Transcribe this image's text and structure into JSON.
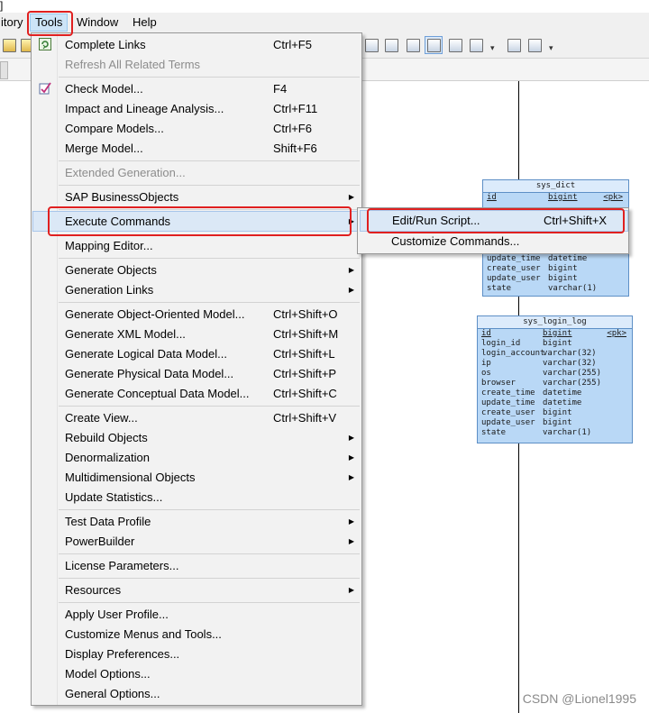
{
  "window": {
    "title_fragment": "]"
  },
  "menubar": [
    {
      "label": "itory"
    },
    {
      "label": "Tools",
      "active": true
    },
    {
      "label": "Window"
    },
    {
      "label": "Help"
    }
  ],
  "tools_menu": {
    "items": [
      {
        "label": "Complete Links",
        "shortcut": "Ctrl+F5"
      },
      {
        "label": "Refresh All Related Terms",
        "shortcut": "",
        "disabled": true
      },
      {
        "label": "Check Model...",
        "shortcut": "F4",
        "icon": "check-model-icon"
      },
      {
        "label": "Impact and Lineage Analysis...",
        "shortcut": "Ctrl+F11"
      },
      {
        "label": "Compare Models...",
        "shortcut": "Ctrl+F6"
      },
      {
        "label": "Merge Model...",
        "shortcut": "Shift+F6"
      },
      {
        "label": "Extended Generation...",
        "shortcut": "",
        "disabled": true
      },
      {
        "label": "SAP BusinessObjects",
        "submenu": true
      },
      {
        "label": "Execute Commands",
        "submenu": true,
        "highlighted": true
      },
      {
        "label": "Mapping Editor..."
      },
      {
        "label": "Generate Objects",
        "submenu": true
      },
      {
        "label": "Generation Links",
        "submenu": true
      },
      {
        "label": "Generate Object-Oriented Model...",
        "shortcut": "Ctrl+Shift+O"
      },
      {
        "label": "Generate XML Model...",
        "shortcut": "Ctrl+Shift+M"
      },
      {
        "label": "Generate Logical Data Model...",
        "shortcut": "Ctrl+Shift+L"
      },
      {
        "label": "Generate Physical Data Model...",
        "shortcut": "Ctrl+Shift+P"
      },
      {
        "label": "Generate Conceptual Data Model...",
        "shortcut": "Ctrl+Shift+C"
      },
      {
        "label": "Create View...",
        "shortcut": "Ctrl+Shift+V"
      },
      {
        "label": "Rebuild Objects",
        "submenu": true
      },
      {
        "label": "Denormalization",
        "submenu": true
      },
      {
        "label": "Multidimensional Objects",
        "submenu": true
      },
      {
        "label": "Update Statistics..."
      },
      {
        "label": "Test Data Profile",
        "submenu": true
      },
      {
        "label": "PowerBuilder",
        "submenu": true
      },
      {
        "label": "License Parameters..."
      },
      {
        "label": "Resources",
        "submenu": true
      },
      {
        "label": "Apply User Profile..."
      },
      {
        "label": "Customize Menus and Tools..."
      },
      {
        "label": "Display Preferences..."
      },
      {
        "label": "Model Options..."
      },
      {
        "label": "General Options..."
      }
    ]
  },
  "execute_submenu": {
    "items": [
      {
        "label": "Edit/Run Script...",
        "shortcut": "Ctrl+Shift+X",
        "highlighted": true
      },
      {
        "label": "Customize Commands..."
      }
    ]
  },
  "sys_dict": {
    "title": "sys_dict",
    "rows_top": [
      {
        "name": "id",
        "type": "bigint",
        "key": "<pk>"
      }
    ],
    "rows_bottom": [
      {
        "name": "update_time",
        "type": "datetime"
      },
      {
        "name": "create_user",
        "type": "bigint"
      },
      {
        "name": "update_user",
        "type": "bigint"
      },
      {
        "name": "state",
        "type": "varchar(1)"
      }
    ]
  },
  "sys_login_log": {
    "title": "sys_login_log",
    "rows": [
      {
        "name": "id",
        "type": "bigint",
        "key": "<pk>"
      },
      {
        "name": "login_id",
        "type": "bigint"
      },
      {
        "name": "login_account",
        "type": "varchar(32)"
      },
      {
        "name": "ip",
        "type": "varchar(32)"
      },
      {
        "name": "os",
        "type": "varchar(255)"
      },
      {
        "name": "browser",
        "type": "varchar(255)"
      },
      {
        "name": "create_time",
        "type": "datetime"
      },
      {
        "name": "update_time",
        "type": "datetime"
      },
      {
        "name": "create_user",
        "type": "bigint"
      },
      {
        "name": "update_user",
        "type": "bigint"
      },
      {
        "name": "state",
        "type": "varchar(1)"
      }
    ]
  },
  "watermark": "CSDN @Lionel1995",
  "colors": {
    "highlight_box": "#e02020",
    "menu_highlight": "#dbe8f6",
    "entity_fill": "#b9d8f6"
  }
}
